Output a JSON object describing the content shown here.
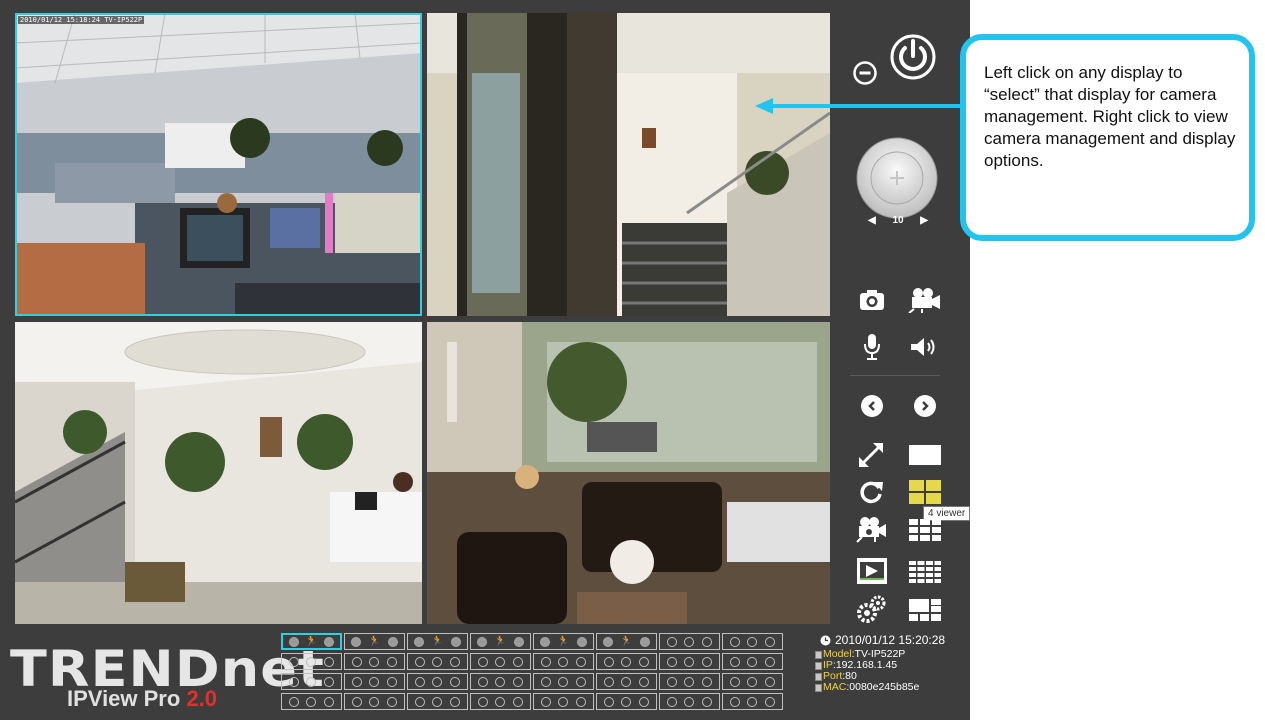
{
  "viewer": {
    "tiles": [
      {
        "timestamp": "2010/01/12 15:18:24 TV-IP522P",
        "selected": true
      },
      {
        "timestamp": "",
        "selected": false
      },
      {
        "timestamp": "",
        "selected": false
      },
      {
        "timestamp": "",
        "selected": false
      }
    ]
  },
  "controls": {
    "ptz_speed": "10",
    "tooltip": "4 viewer",
    "icons": [
      "minimize-icon",
      "power-icon",
      "ptz-joystick",
      "snapshot-camera-icon",
      "record-video-icon",
      "microphone-icon",
      "speaker-icon",
      "previous-icon",
      "next-icon",
      "fullscreen-icon",
      "single-view-icon",
      "refresh-icon",
      "four-view-icon",
      "auto-record-icon",
      "nine-view-icon",
      "playback-icon",
      "sixteen-view-icon",
      "settings-icon",
      "custom-layout-icon"
    ]
  },
  "branding": {
    "brand": "TRENDnet",
    "product": "IPView Pro",
    "version": "2.0"
  },
  "cam_slots": {
    "active_count": 6,
    "selected_index": 0,
    "runner_glyph": "🏃"
  },
  "info": {
    "datetime": "2010/01/12 15:20:28",
    "model_label": "Model",
    "model": ":TV-IP522P",
    "ip_label": "IP",
    "ip": ":192.168.1.45",
    "port_label": "Port",
    "port": ":80",
    "mac_label": "MAC",
    "mac": ":0080e245b85e"
  },
  "callout": {
    "text": "Left click on any display to “select” that display for camera management. Right click to view camera management and display options."
  }
}
